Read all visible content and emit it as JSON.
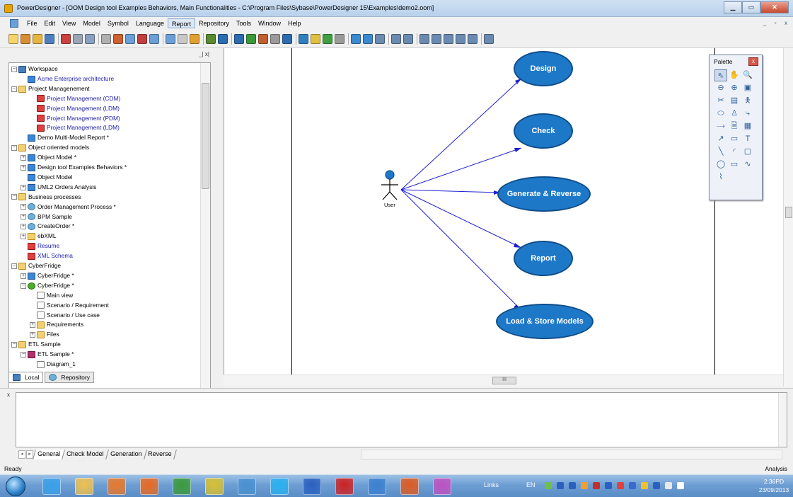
{
  "window": {
    "title": "PowerDesigner - [OOM Design tool Examples Behaviors, Main Functionalities - C:\\Program Files\\Sybase\\PowerDesigner 15\\Examples\\demo2.oom]",
    "minimize": "▁",
    "maximize": "▭",
    "close": "✕"
  },
  "menu": {
    "items": [
      "File",
      "Edit",
      "View",
      "Model",
      "Symbol",
      "Language",
      "Report",
      "Repository",
      "Tools",
      "Window",
      "Help"
    ],
    "active": "Report",
    "mdi": [
      "_",
      "▫",
      "x"
    ]
  },
  "panel": {
    "header_controls": "_| x|",
    "tabs": [
      "Local",
      "Repository"
    ]
  },
  "tree": [
    {
      "label": "Workspace",
      "level": 0,
      "exp": "-",
      "icon": "ws",
      "link": false
    },
    {
      "label": "Acme Enterprise architecture",
      "level": 1,
      "exp": "",
      "icon": "obj",
      "link": true
    },
    {
      "label": "Project Managenement",
      "level": 0,
      "exp": "-",
      "icon": "folder",
      "link": false
    },
    {
      "label": "Project Management (CDM)",
      "level": 2,
      "exp": "",
      "icon": "model",
      "link": true
    },
    {
      "label": "Project Management (LDM)",
      "level": 2,
      "exp": "",
      "icon": "model",
      "link": true
    },
    {
      "label": "Project Management (PDM)",
      "level": 2,
      "exp": "",
      "icon": "model",
      "link": true
    },
    {
      "label": "Project Management (LDM)",
      "level": 2,
      "exp": "",
      "icon": "model",
      "link": true
    },
    {
      "label": "Demo Multi-Model Report *",
      "level": 1,
      "exp": "",
      "icon": "obj",
      "link": false
    },
    {
      "label": "Object oriented models",
      "level": 0,
      "exp": "-",
      "icon": "folder",
      "link": false
    },
    {
      "label": "Object Model *",
      "level": 1,
      "exp": "+",
      "icon": "obj",
      "link": false
    },
    {
      "label": "Design tool Examples Behaviors *",
      "level": 1,
      "exp": "+",
      "icon": "obj",
      "link": false
    },
    {
      "label": "Object Model",
      "level": 1,
      "exp": "",
      "icon": "obj",
      "link": false
    },
    {
      "label": "UML2 Orders Analysis",
      "level": 1,
      "exp": "+",
      "icon": "obj",
      "link": false
    },
    {
      "label": "Business processes",
      "level": 0,
      "exp": "-",
      "icon": "folder",
      "link": false
    },
    {
      "label": "Order Management Process *",
      "level": 1,
      "exp": "+",
      "icon": "bpm",
      "link": false
    },
    {
      "label": "BPM Sample",
      "level": 1,
      "exp": "+",
      "icon": "bpm",
      "link": false
    },
    {
      "label": "CreateOrder *",
      "level": 1,
      "exp": "+",
      "icon": "bpm",
      "link": false
    },
    {
      "label": "ebXML",
      "level": 1,
      "exp": "+",
      "icon": "folder",
      "link": false
    },
    {
      "label": "Resume",
      "level": 1,
      "exp": "",
      "icon": "model",
      "link": true
    },
    {
      "label": "XML Schema",
      "level": 1,
      "exp": "",
      "icon": "model",
      "link": true
    },
    {
      "label": "CyberFridge",
      "level": 0,
      "exp": "-",
      "icon": "folder",
      "link": false
    },
    {
      "label": "CyberFridge *",
      "level": 1,
      "exp": "+",
      "icon": "obj",
      "link": false
    },
    {
      "label": "CyberFridge *",
      "level": 1,
      "exp": "-",
      "icon": "green",
      "link": false
    },
    {
      "label": "Main view",
      "level": 2,
      "exp": "",
      "icon": "doc",
      "link": false
    },
    {
      "label": "Scenario / Requirement",
      "level": 2,
      "exp": "",
      "icon": "doc",
      "link": false
    },
    {
      "label": "Scenario / Use case",
      "level": 2,
      "exp": "",
      "icon": "doc",
      "link": false
    },
    {
      "label": "Requirements",
      "level": 2,
      "exp": "+",
      "icon": "folder",
      "link": false
    },
    {
      "label": "Files",
      "level": 2,
      "exp": "+",
      "icon": "folder",
      "link": false
    },
    {
      "label": "ETL Sample",
      "level": 0,
      "exp": "-",
      "icon": "folder",
      "link": false
    },
    {
      "label": "ETL Sample *",
      "level": 1,
      "exp": "-",
      "icon": "etl",
      "link": false
    },
    {
      "label": "Diagram_1",
      "level": 2,
      "exp": "",
      "icon": "doc",
      "link": false
    }
  ],
  "diagram": {
    "actor": "User",
    "use_cases": [
      "Design",
      "Check",
      "Generate & Reverse",
      "Report",
      "Load & Store Models"
    ],
    "usecase_fill": "#1e78c8",
    "line_color": "#2020d0"
  },
  "palette": {
    "title": "Palette",
    "close": "x",
    "tools": [
      "pointer-icon",
      "grabber-icon",
      "zoom-in-icon",
      "zoom-out-icon",
      "zoom-icon",
      "properties-icon",
      "cut-icon",
      "package-icon",
      "actor-icon",
      "use-case-icon",
      "actor2-icon",
      "dependency-icon",
      "realize-icon",
      "note-icon",
      "file-icon",
      "link-icon",
      "rounded-icon",
      "text-icon",
      "line-icon",
      "arc-icon",
      "rectangle-icon",
      "ellipse-icon",
      "rounded-rect-icon",
      "polyline-icon",
      "polygon-icon"
    ],
    "glyphs": [
      "⇖",
      "✋",
      "🔍",
      "⊖",
      "⊕",
      "▣",
      "✂",
      "▤",
      "🯅",
      "⬭",
      "♙",
      "⤷",
      "⤏",
      "🗎",
      "▦",
      "↗",
      "▭",
      "T",
      "╲",
      "◜",
      "▢",
      "◯",
      "▭",
      "∿",
      "⌇"
    ]
  },
  "output": {
    "side": "x",
    "tabs": [
      "General",
      "Check Model",
      "Generation",
      "Reverse"
    ],
    "active_tab": "General"
  },
  "status": {
    "left": "Ready",
    "right": "Analysis"
  },
  "taskbar": {
    "links": "Links",
    "lang": "EN",
    "time": "2:36PD",
    "date": "23/09/2013"
  },
  "scroll": {
    "h_thumb": "III"
  }
}
